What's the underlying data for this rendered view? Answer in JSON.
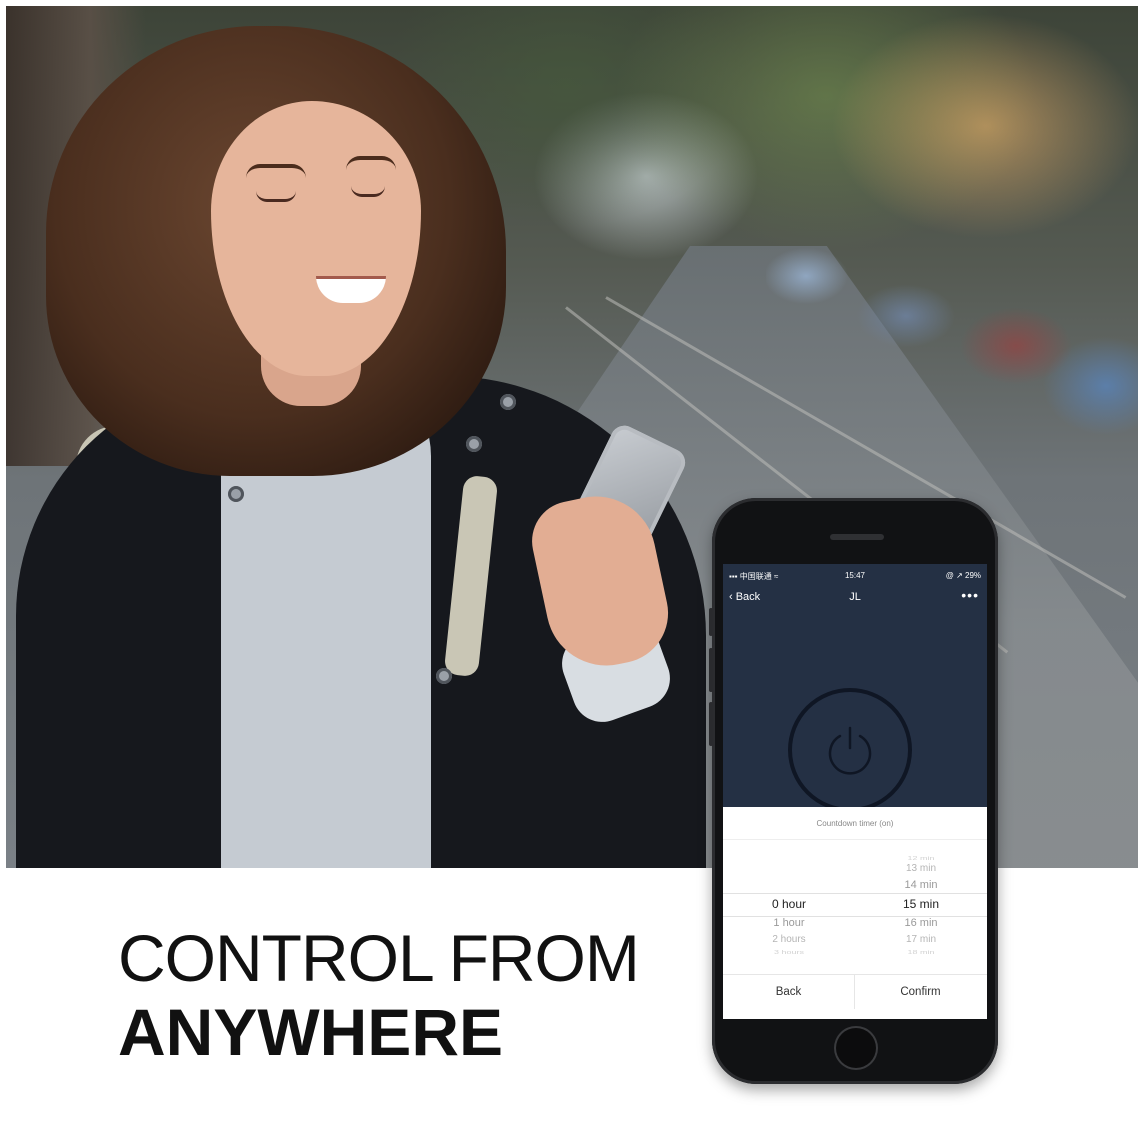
{
  "headline": {
    "line1": "CONTROL FROM",
    "line2": "ANYWHERE"
  },
  "phone": {
    "statusbar": {
      "carrier": "▪▪▪ 中国联通 ≈",
      "time": "15:47",
      "battery": "@ ↗ 29%"
    },
    "navbar": {
      "back_label": "‹ Back",
      "title": "JL",
      "more": "•••"
    },
    "timer_sheet": {
      "title": "Countdown timer (on)",
      "hours": [
        "0 hour",
        "1 hour",
        "2 hours",
        "3 hours"
      ],
      "minutes": [
        "12 min",
        "13 min",
        "14 min",
        "15 min",
        "16 min",
        "17 min",
        "18 min"
      ],
      "selected_hours": "0 hour",
      "selected_minutes": "15 min",
      "back_button": "Back",
      "confirm_button": "Confirm"
    }
  },
  "colors": {
    "app_background": "#243044",
    "headline_text": "#111111"
  }
}
